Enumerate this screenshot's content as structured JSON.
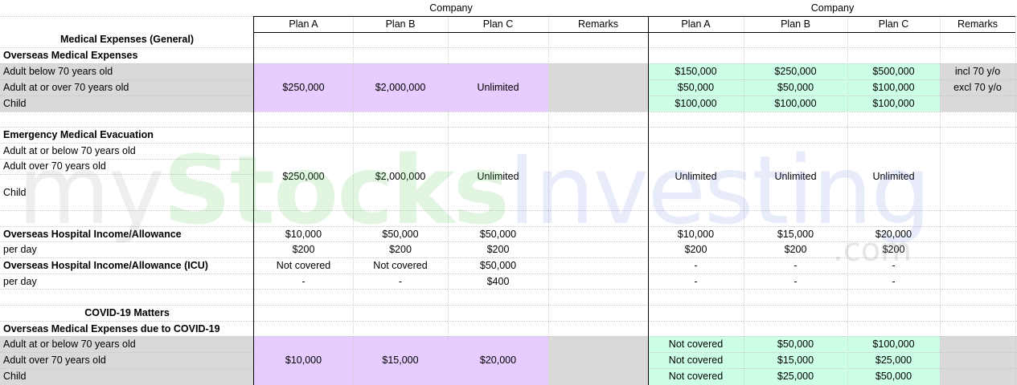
{
  "header": {
    "group_left": "Company",
    "group_right": "Company",
    "columns": [
      "Plan A",
      "Plan B",
      "Plan C",
      "Remarks",
      "Plan A",
      "Plan B",
      "Plan C",
      "Remarks"
    ]
  },
  "sections": {
    "medical_general": "Medical Expenses (General)",
    "overseas_medical": "Overseas Medical Expenses",
    "emergency_evac": "Emergency Medical Evacuation",
    "hospital_income": "Overseas Hospital Income/Allowance",
    "hospital_icu": "Overseas Hospital Income/Allowance (ICU)",
    "covid": "COVID-19 Matters",
    "covid_medical": "Overseas Medical Expenses due to COVID-19"
  },
  "rows": {
    "om_adult_below70": "Adult below 70 years old",
    "om_adult_over70": "Adult at or over 70 years old",
    "om_child": "Child",
    "ev_adult_below70": "Adult at or below 70 years old",
    "ev_adult_over70": "Adult over 70 years old",
    "ev_child": "Child",
    "hi_per_day": "per day",
    "icu_per_day": "per day",
    "cv_adult_below70": "Adult at or below 70 years old",
    "cv_adult_over70": "Adult over 70 years old",
    "cv_child": "Child"
  },
  "left": {
    "overseas_medical": [
      "$250,000",
      "$2,000,000",
      "Unlimited"
    ],
    "evacuation": [
      "$250,000",
      "$2,000,000",
      "Unlimited"
    ],
    "hospital_income": [
      "$10,000",
      "$50,000",
      "$50,000"
    ],
    "hospital_income_per_day": [
      "$200",
      "$200",
      "$200"
    ],
    "icu": [
      "Not covered",
      "Not covered",
      "$50,000"
    ],
    "icu_per_day": [
      "-",
      "-",
      "$400"
    ],
    "covid_medical": [
      "$10,000",
      "$15,000",
      "$20,000"
    ]
  },
  "right": {
    "om_adult_below70": [
      "$150,000",
      "$250,000",
      "$500,000"
    ],
    "om_adult_over70": [
      "$50,000",
      "$50,000",
      "$100,000"
    ],
    "om_child": [
      "$100,000",
      "$100,000",
      "$100,000"
    ],
    "om_remark_below70": "incl 70 y/o",
    "om_remark_over70": "excl 70 y/o",
    "evacuation": [
      "Unlimited",
      "Unlimited",
      "Unlimited"
    ],
    "hospital_income": [
      "$10,000",
      "$15,000",
      "$20,000"
    ],
    "hospital_income_per_day": [
      "$200",
      "$200",
      "$200"
    ],
    "icu": [
      "-",
      "-",
      "-"
    ],
    "icu_per_day": [
      "-",
      "-",
      "-"
    ],
    "cv_adult_below70": [
      "Not covered",
      "$50,000",
      "$100,000"
    ],
    "cv_adult_over70": [
      "Not covered",
      "$15,000",
      "$25,000"
    ],
    "cv_child": [
      "Not covered",
      "$25,000",
      "$50,000"
    ]
  },
  "watermark": {
    "part1": "my",
    "part2": "Stocks",
    "part3": "Investing",
    "suffix": ".com"
  },
  "colors": {
    "grey_row": "#d9d9d9",
    "purple_fill": "#e6ccff",
    "green_fill": "#ccffe6"
  }
}
